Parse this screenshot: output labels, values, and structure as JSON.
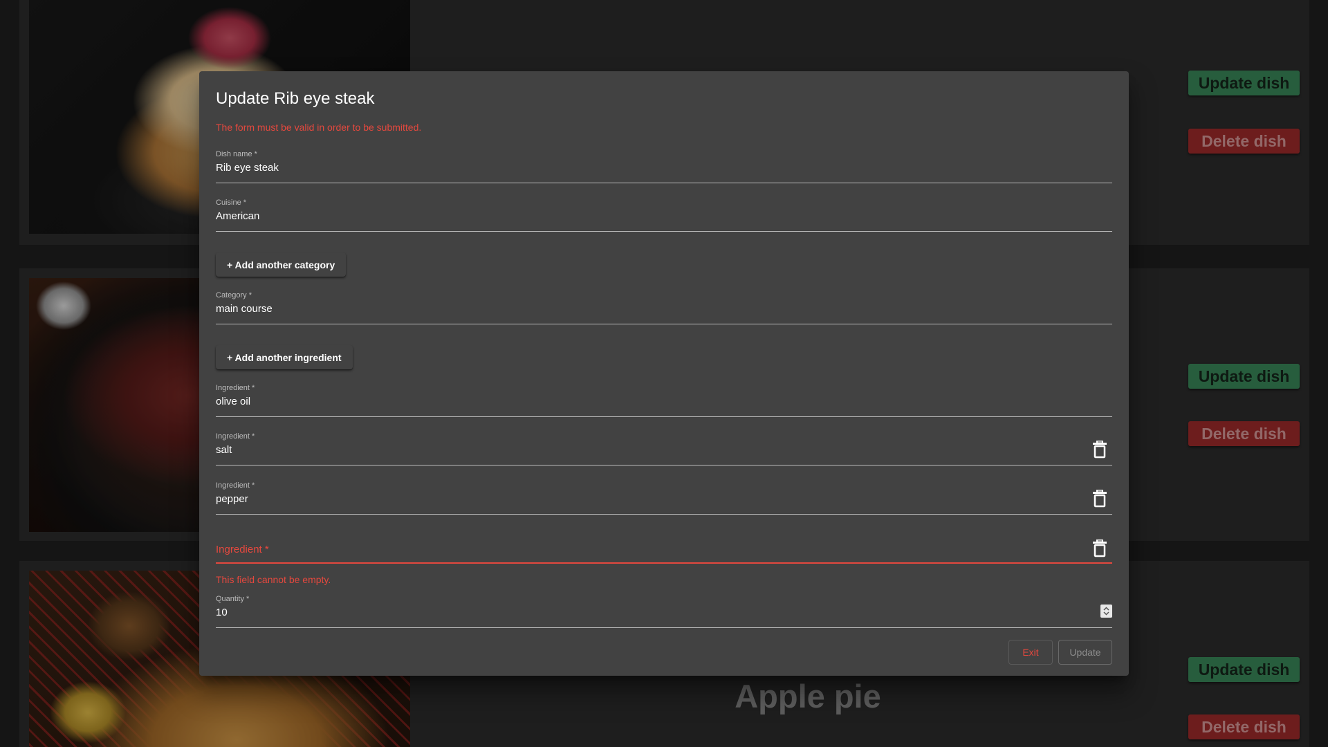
{
  "dishes": [
    {
      "image": "pancake-image",
      "update_label": "Update dish",
      "delete_label": "Delete dish"
    },
    {
      "image": "steak-image",
      "update_label": "Update dish",
      "delete_label": "Delete dish"
    },
    {
      "image": "apple-pie-image",
      "title": "Apple pie",
      "update_label": "Update dish",
      "delete_label": "Delete dish"
    }
  ],
  "dialog": {
    "title": "Update Rib eye steak",
    "form_error": "The form must be valid in order to be submitted.",
    "dish_name": {
      "label": "Dish name *",
      "value": "Rib eye steak"
    },
    "cuisine": {
      "label": "Cuisine *",
      "value": "American"
    },
    "add_category_label": "+ Add another category",
    "category": {
      "label": "Category *",
      "value": "main course"
    },
    "add_ingredient_label": "+ Add another ingredient",
    "ingredients": [
      {
        "label": "Ingredient *",
        "value": "olive oil"
      },
      {
        "label": "Ingredient *",
        "value": "salt"
      },
      {
        "label": "Ingredient *",
        "value": "pepper"
      },
      {
        "label": "Ingredient *",
        "value": ""
      }
    ],
    "ingredient_error": "This field cannot be empty.",
    "quantity": {
      "label": "Quantity *",
      "value": "10"
    },
    "exit_label": "Exit",
    "update_label": "Update"
  },
  "colors": {
    "error": "#e5483e",
    "update_dish": "#3a8a5a",
    "delete_dish": "#a12c2c",
    "dialog_bg": "#424242"
  },
  "icons": {
    "delete_field": "trash-icon",
    "stepper": "stepper-icon"
  }
}
